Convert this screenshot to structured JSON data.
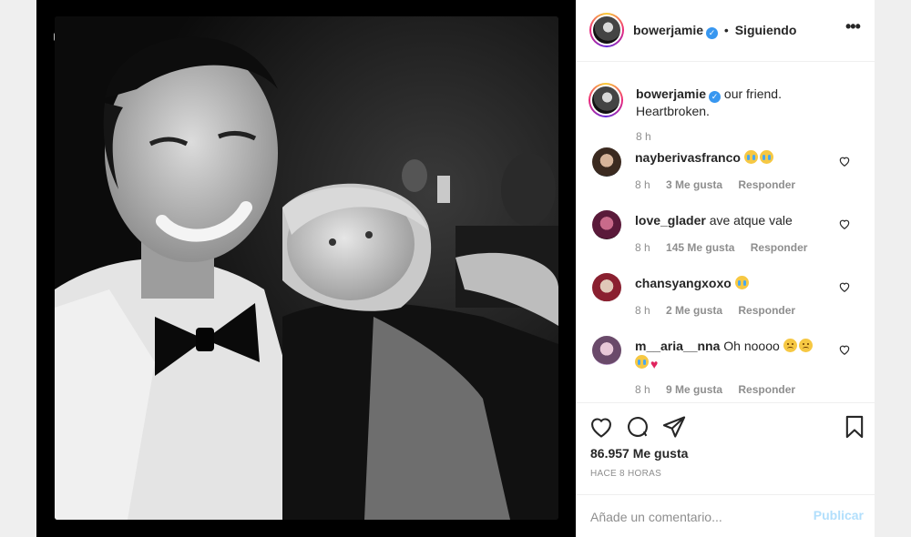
{
  "post": {
    "username": "bowerjamie",
    "follow_separator": "•",
    "follow_status": "Siguiendo",
    "more_icon": "more-horizontal-icon",
    "caption": "our friend. Heartbroken.",
    "caption_time": "8 h"
  },
  "comments": [
    {
      "username": "nayberivasfranco",
      "text": "",
      "emojis": [
        "cry",
        "cry"
      ],
      "time": "8 h",
      "likes": "3 Me gusta",
      "reply": "Responder"
    },
    {
      "username": "love_glader",
      "text": "ave atque vale",
      "emojis": [],
      "time": "8 h",
      "likes": "145 Me gusta",
      "reply": "Responder"
    },
    {
      "username": "chansyangxoxo",
      "text": "",
      "emojis": [
        "cry"
      ],
      "time": "8 h",
      "likes": "2 Me gusta",
      "reply": "Responder"
    },
    {
      "username": "m__aria__nna",
      "text": "Oh noooo",
      "emojis": [
        "sad",
        "sad",
        "cry",
        "heart"
      ],
      "time": "8 h",
      "likes": "9 Me gusta",
      "reply": "Responder"
    }
  ],
  "actions": {
    "like_icon": "heart-icon",
    "comment_icon": "comment-icon",
    "share_icon": "paper-plane-icon",
    "save_icon": "bookmark-icon",
    "likes_count": "86.957 Me gusta",
    "time_ago": "HACE 8 HORAS"
  },
  "comment_box": {
    "placeholder": "Añade un comentario...",
    "publish_label": "Publicar"
  },
  "colors": {
    "accent": "#3897f0",
    "publish_disabled": "#b2dffc",
    "muted": "#8e8e8e",
    "heart_emoji": "#e0245e"
  }
}
